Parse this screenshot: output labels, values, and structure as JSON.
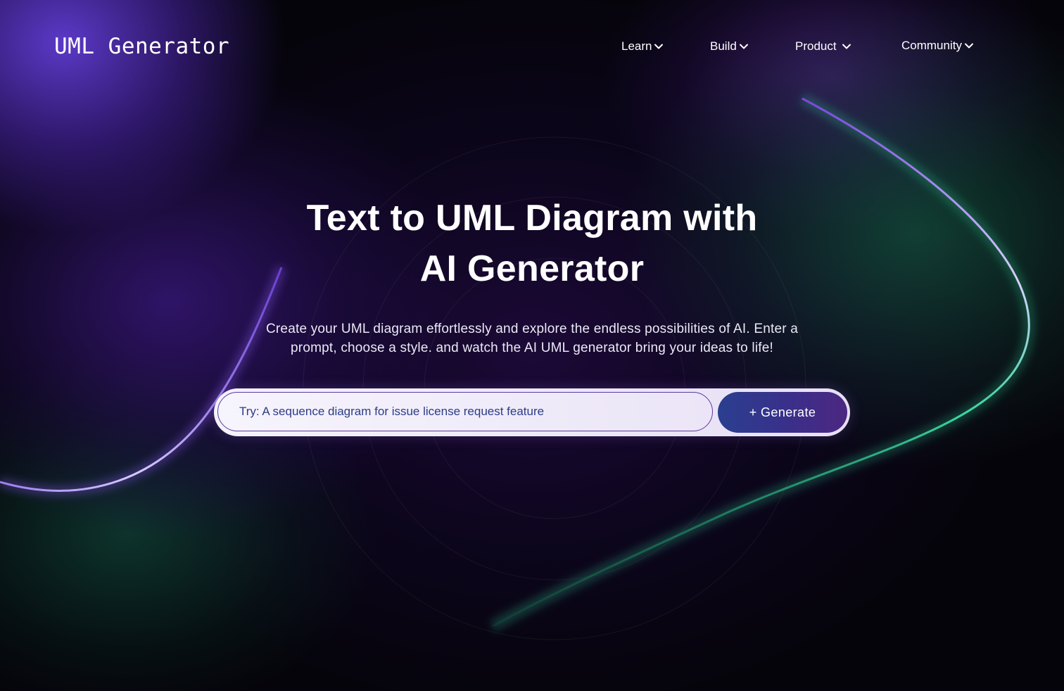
{
  "header": {
    "logo": "UML Generator",
    "nav": [
      {
        "label": "Learn",
        "icon": "chevron-down-icon"
      },
      {
        "label": "Build",
        "icon": "chevron-down-icon"
      },
      {
        "label": "Product",
        "icon": "chevron-down-icon"
      },
      {
        "label": "Community",
        "icon": "chevron-down-icon"
      }
    ]
  },
  "hero": {
    "title_line1": "Text to UML Diagram with",
    "title_line2": "AI Generator",
    "subtitle_line1": "Create your UML diagram effortlessly and explore the endless possibilities of AI. Enter a",
    "subtitle_line2": "prompt, choose a style. and watch the AI UML generator bring your ideas to life!"
  },
  "prompt": {
    "placeholder": "Try: A sequence diagram for issue license request feature",
    "value": "",
    "button_label": "+ Generate"
  },
  "colors": {
    "background": "#05040a",
    "accent_purple": "#4c2781",
    "accent_blue": "#2a3f8f",
    "glow_green": "#2fd39a",
    "glow_violet": "#8a5cf0"
  }
}
